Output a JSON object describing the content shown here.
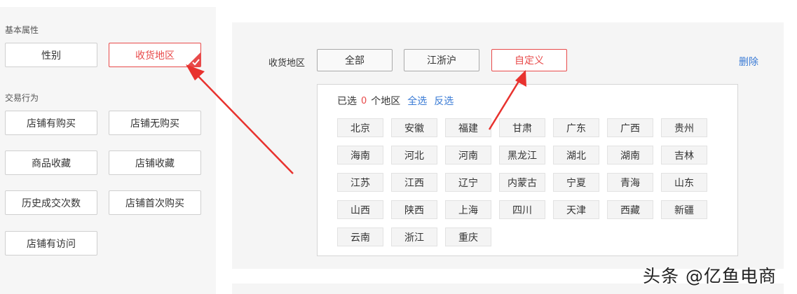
{
  "left": {
    "basic_section": "基本属性",
    "basic_items": [
      "性别",
      "收货地区"
    ],
    "trade_section": "交易行为",
    "trade_items": [
      "店铺有购买",
      "店铺无购买",
      "商品收藏",
      "店铺收藏",
      "历史成交次数",
      "店铺首次购买",
      "店铺有访问"
    ]
  },
  "right": {
    "field_label": "收货地区",
    "options": [
      "全部",
      "江浙沪",
      "自定义"
    ],
    "selected_option": "自定义",
    "delete_label": "删除",
    "selection": {
      "prefix": "已选",
      "count": "0",
      "suffix": "个地区",
      "select_all": "全选",
      "invert": "反选"
    },
    "regions": [
      "北京",
      "安徽",
      "福建",
      "甘肃",
      "广东",
      "广西",
      "贵州",
      "海南",
      "河北",
      "河南",
      "黑龙江",
      "湖北",
      "湖南",
      "吉林",
      "江苏",
      "江西",
      "辽宁",
      "内蒙古",
      "宁夏",
      "青海",
      "山东",
      "山西",
      "陕西",
      "上海",
      "四川",
      "天津",
      "西藏",
      "新疆",
      "云南",
      "浙江",
      "重庆"
    ]
  },
  "colors": {
    "accent_red": "#e84a4a",
    "link_blue": "#3a7bd5",
    "arrow_red": "#e8322e"
  },
  "watermark": "头条 @亿鱼电商"
}
